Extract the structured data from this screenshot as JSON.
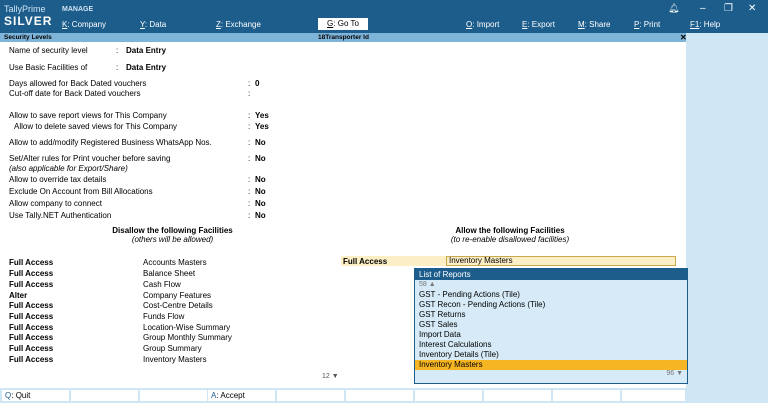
{
  "app": {
    "brand_top": "TallyPrime",
    "brand_edition": "SILVER",
    "manage_label": "MANAGE"
  },
  "menu": {
    "company": {
      "key": "K",
      "label": "Company"
    },
    "data": {
      "key": "Y",
      "label": "Data"
    },
    "exchange": {
      "key": "Z",
      "label": "Exchange"
    },
    "goto": {
      "key": "G",
      "label": "Go To"
    },
    "import": {
      "key": "O",
      "label": "Import"
    },
    "export": {
      "key": "E",
      "label": "Export"
    },
    "share": {
      "key": "M",
      "label": "Share"
    },
    "print": {
      "key": "P",
      "label": "Print"
    },
    "help": {
      "key": "F1",
      "label": "Help"
    }
  },
  "titlebar": {
    "left": "Security Levels",
    "center": "18Transporter Id"
  },
  "form": {
    "name_label": "Name of security level",
    "name_value": "Data Entry",
    "basic_label": "Use Basic Facilities of",
    "basic_value": "Data Entry",
    "days_label": "Days allowed for Back Dated vouchers",
    "days_value": "0",
    "cutoff_label": "Cut-off date for Back Dated vouchers",
    "cutoff_value": "",
    "save_views_label": "Allow to save report views for This Company",
    "save_views_value": "Yes",
    "delete_views_label": "Allow to delete saved views for This Company",
    "delete_views_value": "Yes",
    "whatsapp_label": "Allow to add/modify Registered Business WhatsApp Nos.",
    "whatsapp_value": "No",
    "print_rules_label": "Set/Alter rules for Print voucher before saving",
    "print_rules_sub": "(also applicable for Export/Share)",
    "print_rules_value": "No",
    "override_tax_label": "Allow to override tax details",
    "override_tax_value": "No",
    "exclude_label": "Exclude On Account from Bill Allocations",
    "exclude_value": "No",
    "connect_label": "Allow company to connect",
    "connect_value": "No",
    "tallynet_label": "Use Tally.NET Authentication",
    "tallynet_value": "No"
  },
  "disallow": {
    "title": "Disallow the following Facilities",
    "subtitle": "(others will be allowed)",
    "rows": [
      {
        "access": "Full Access",
        "facility": "Accounts Masters"
      },
      {
        "access": "Full Access",
        "facility": "Balance Sheet"
      },
      {
        "access": "Full Access",
        "facility": "Cash Flow"
      },
      {
        "access": "Alter",
        "facility": "Company Features"
      },
      {
        "access": "Full Access",
        "facility": "Cost-Centre Details"
      },
      {
        "access": "Full Access",
        "facility": "Funds Flow"
      },
      {
        "access": "Full Access",
        "facility": "Location-Wise Summary"
      },
      {
        "access": "Full Access",
        "facility": "Group Monthly Summary"
      },
      {
        "access": "Full Access",
        "facility": "Group Summary"
      },
      {
        "access": "Full Access",
        "facility": "Inventory Masters"
      }
    ],
    "more_count": "12"
  },
  "allow": {
    "title": "Allow the following Facilities",
    "subtitle": "(to re-enable disallowed facilities)",
    "access": "Full Access",
    "input_value": "Inventory Masters"
  },
  "list_of_reports": {
    "title": "List of Reports",
    "count_above": "58",
    "items": [
      "GST - Pending Actions (Tile)",
      "GST Recon - Pending Actions (Tile)",
      "GST Returns",
      "GST Sales",
      "Import Data",
      "Interest Calculations",
      "Inventory Details (Tile)",
      "Inventory Masters"
    ],
    "selected_index": 7,
    "count_below": "96"
  },
  "bottombar": {
    "quit": {
      "key": "Q",
      "label": "Quit"
    },
    "accept": {
      "key": "A",
      "label": "Accept"
    }
  },
  "colors": {
    "header_blue": "#1c5d8c",
    "title_strip": "#7fb4d9",
    "panel": "#cfe7f5",
    "highlight": "#f6b624",
    "input_bg": "#fcefc6"
  }
}
